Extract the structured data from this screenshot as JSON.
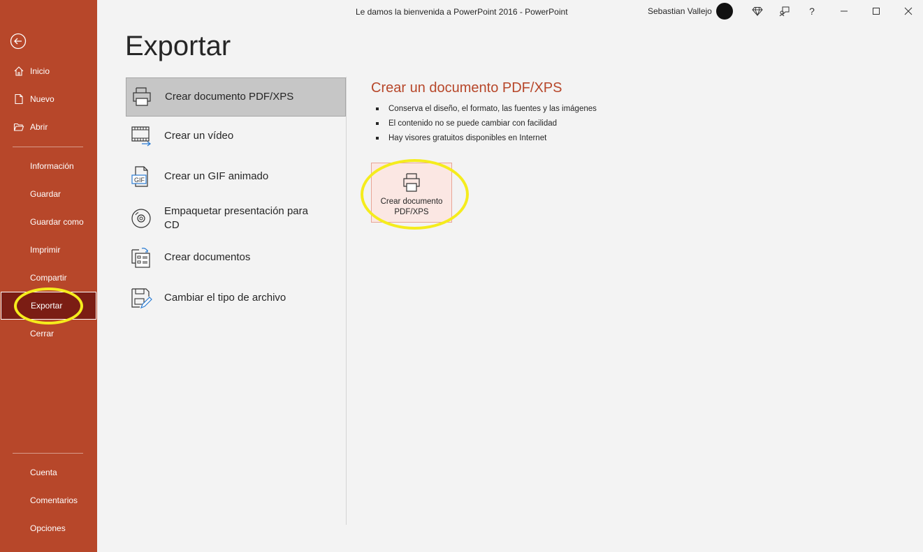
{
  "window": {
    "title": "Le damos la bienvenida a PowerPoint 2016  -  PowerPoint",
    "user_name": "Sebastian Vallejo"
  },
  "sidebar": {
    "top_items": [
      {
        "label": "Inicio",
        "icon": "home-icon"
      },
      {
        "label": "Nuevo",
        "icon": "new-document-icon"
      },
      {
        "label": "Abrir",
        "icon": "folder-open-icon"
      }
    ],
    "middle_items": [
      {
        "label": "Información"
      },
      {
        "label": "Guardar"
      },
      {
        "label": "Guardar como"
      },
      {
        "label": "Imprimir"
      },
      {
        "label": "Compartir"
      },
      {
        "label": "Exportar"
      },
      {
        "label": "Cerrar"
      }
    ],
    "bottom_items": [
      {
        "label": "Cuenta"
      },
      {
        "label": "Comentarios"
      },
      {
        "label": "Opciones"
      }
    ],
    "active": "Exportar"
  },
  "main": {
    "title": "Exportar",
    "options": [
      {
        "label": "Crear documento PDF/XPS",
        "icon": "pdf-document-icon"
      },
      {
        "label": "Crear un vídeo",
        "icon": "video-icon"
      },
      {
        "label": "Crear un GIF animado",
        "icon": "gif-icon",
        "badge": "GIF"
      },
      {
        "label": "Empaquetar presentación para CD",
        "icon": "cd-icon"
      },
      {
        "label": "Crear documentos",
        "icon": "handouts-icon"
      },
      {
        "label": "Cambiar el tipo de archivo",
        "icon": "change-file-type-icon"
      }
    ],
    "selected": "Crear documento PDF/XPS"
  },
  "detail": {
    "title": "Crear un documento PDF/XPS",
    "bullets": [
      "Conserva el diseño, el formato, las fuentes y las imágenes",
      "El contenido no se puede cambiar con facilidad",
      "Hay visores gratuitos disponibles en Internet"
    ],
    "button_line1": "Crear documento",
    "button_line2": "PDF/XPS"
  },
  "colors": {
    "accent": "#b7472a",
    "active_nav": "#7b1d14",
    "highlight": "#f5ec1d"
  }
}
